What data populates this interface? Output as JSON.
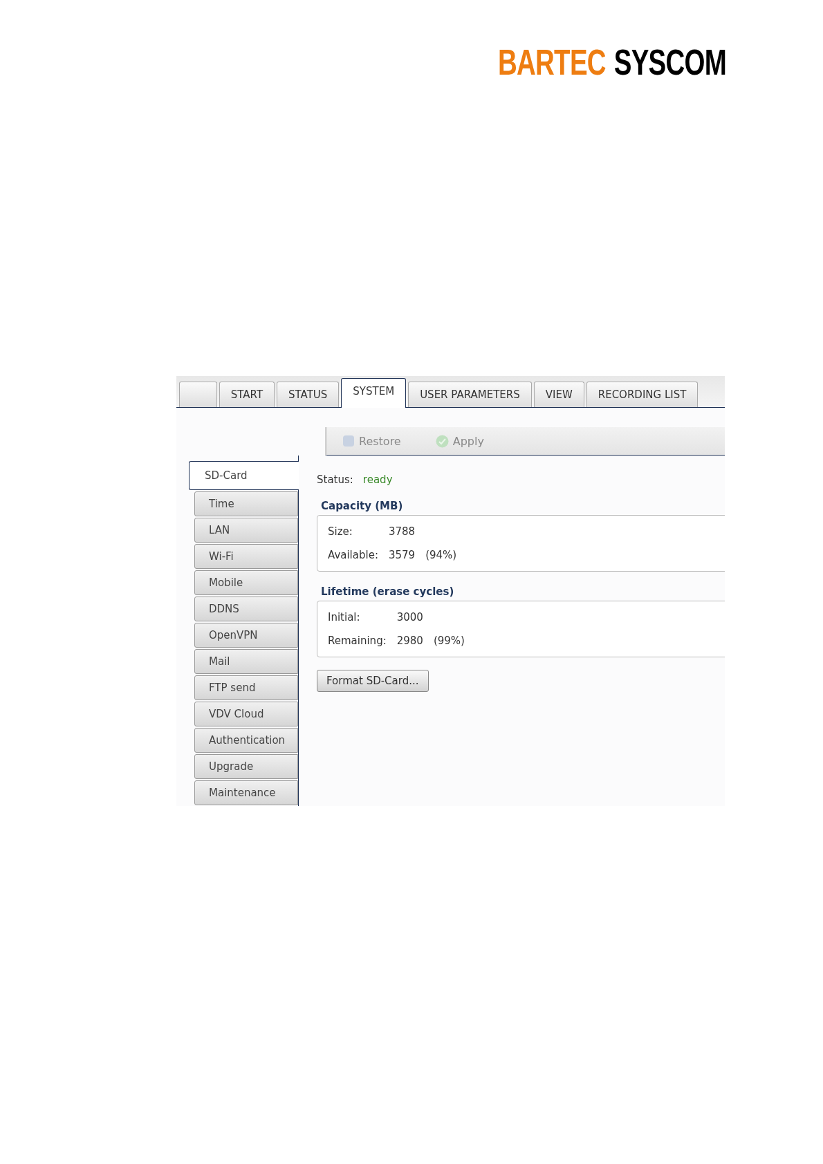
{
  "logo": {
    "brand": "BARTEC",
    "product": "SYSCOM"
  },
  "tabs": [
    {
      "kind": "blank",
      "selected": false
    },
    {
      "label": "START",
      "selected": false
    },
    {
      "label": "STATUS",
      "selected": false
    },
    {
      "label": "SYSTEM",
      "selected": true
    },
    {
      "label": "USER PARAMETERS",
      "selected": false
    },
    {
      "label": "VIEW",
      "selected": false
    },
    {
      "label": "RECORDING LIST",
      "selected": false
    }
  ],
  "toolbar": {
    "buttons": [
      {
        "kind": "restore",
        "label": "Restore",
        "disabled": true
      },
      {
        "kind": "apply",
        "label": "Apply",
        "disabled": true
      }
    ]
  },
  "sidebar": {
    "items": [
      {
        "label": "SD-Card",
        "selected": true
      },
      {
        "label": "Time",
        "selected": false
      },
      {
        "label": "LAN",
        "selected": false
      },
      {
        "label": "Wi-Fi",
        "selected": false
      },
      {
        "label": "Mobile",
        "selected": false
      },
      {
        "label": "DDNS",
        "selected": false
      },
      {
        "label": "OpenVPN",
        "selected": false
      },
      {
        "label": "Mail",
        "selected": false
      },
      {
        "label": "FTP send",
        "selected": false
      },
      {
        "label": "VDV Cloud",
        "selected": false
      },
      {
        "label": "Authentication",
        "selected": false
      },
      {
        "label": "Upgrade",
        "selected": false
      },
      {
        "label": "Maintenance",
        "selected": false
      }
    ]
  },
  "content": {
    "status": {
      "label": "Status:",
      "value": "ready"
    },
    "groups": [
      {
        "title": "Capacity (MB)",
        "rows": [
          {
            "label": "Size:",
            "value": "3788"
          },
          {
            "label": "Available:",
            "value": "3579",
            "percent": "(94%)"
          }
        ]
      },
      {
        "title": "Lifetime (erase cycles)",
        "rows": [
          {
            "label": "Initial:",
            "value": "3000"
          },
          {
            "label": "Remaining:",
            "value": "2980",
            "percent": "(99%)"
          }
        ]
      }
    ],
    "button": "Format SD-Card..."
  }
}
